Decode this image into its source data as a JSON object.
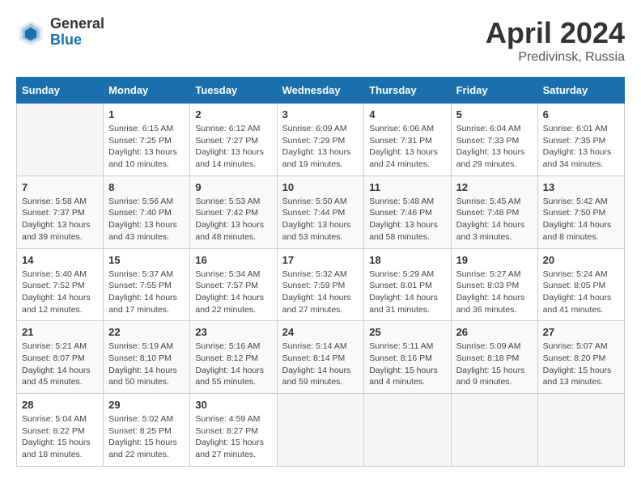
{
  "header": {
    "logo_general": "General",
    "logo_blue": "Blue",
    "title": "April 2024",
    "location": "Predivinsk, Russia"
  },
  "days_of_week": [
    "Sunday",
    "Monday",
    "Tuesday",
    "Wednesday",
    "Thursday",
    "Friday",
    "Saturday"
  ],
  "weeks": [
    [
      {
        "day": "",
        "info": ""
      },
      {
        "day": "1",
        "info": "Sunrise: 6:15 AM\nSunset: 7:25 PM\nDaylight: 13 hours\nand 10 minutes."
      },
      {
        "day": "2",
        "info": "Sunrise: 6:12 AM\nSunset: 7:27 PM\nDaylight: 13 hours\nand 14 minutes."
      },
      {
        "day": "3",
        "info": "Sunrise: 6:09 AM\nSunset: 7:29 PM\nDaylight: 13 hours\nand 19 minutes."
      },
      {
        "day": "4",
        "info": "Sunrise: 6:06 AM\nSunset: 7:31 PM\nDaylight: 13 hours\nand 24 minutes."
      },
      {
        "day": "5",
        "info": "Sunrise: 6:04 AM\nSunset: 7:33 PM\nDaylight: 13 hours\nand 29 minutes."
      },
      {
        "day": "6",
        "info": "Sunrise: 6:01 AM\nSunset: 7:35 PM\nDaylight: 13 hours\nand 34 minutes."
      }
    ],
    [
      {
        "day": "7",
        "info": "Sunrise: 5:58 AM\nSunset: 7:37 PM\nDaylight: 13 hours\nand 39 minutes."
      },
      {
        "day": "8",
        "info": "Sunrise: 5:56 AM\nSunset: 7:40 PM\nDaylight: 13 hours\nand 43 minutes."
      },
      {
        "day": "9",
        "info": "Sunrise: 5:53 AM\nSunset: 7:42 PM\nDaylight: 13 hours\nand 48 minutes."
      },
      {
        "day": "10",
        "info": "Sunrise: 5:50 AM\nSunset: 7:44 PM\nDaylight: 13 hours\nand 53 minutes."
      },
      {
        "day": "11",
        "info": "Sunrise: 5:48 AM\nSunset: 7:46 PM\nDaylight: 13 hours\nand 58 minutes."
      },
      {
        "day": "12",
        "info": "Sunrise: 5:45 AM\nSunset: 7:48 PM\nDaylight: 14 hours\nand 3 minutes."
      },
      {
        "day": "13",
        "info": "Sunrise: 5:42 AM\nSunset: 7:50 PM\nDaylight: 14 hours\nand 8 minutes."
      }
    ],
    [
      {
        "day": "14",
        "info": "Sunrise: 5:40 AM\nSunset: 7:52 PM\nDaylight: 14 hours\nand 12 minutes."
      },
      {
        "day": "15",
        "info": "Sunrise: 5:37 AM\nSunset: 7:55 PM\nDaylight: 14 hours\nand 17 minutes."
      },
      {
        "day": "16",
        "info": "Sunrise: 5:34 AM\nSunset: 7:57 PM\nDaylight: 14 hours\nand 22 minutes."
      },
      {
        "day": "17",
        "info": "Sunrise: 5:32 AM\nSunset: 7:59 PM\nDaylight: 14 hours\nand 27 minutes."
      },
      {
        "day": "18",
        "info": "Sunrise: 5:29 AM\nSunset: 8:01 PM\nDaylight: 14 hours\nand 31 minutes."
      },
      {
        "day": "19",
        "info": "Sunrise: 5:27 AM\nSunset: 8:03 PM\nDaylight: 14 hours\nand 36 minutes."
      },
      {
        "day": "20",
        "info": "Sunrise: 5:24 AM\nSunset: 8:05 PM\nDaylight: 14 hours\nand 41 minutes."
      }
    ],
    [
      {
        "day": "21",
        "info": "Sunrise: 5:21 AM\nSunset: 8:07 PM\nDaylight: 14 hours\nand 45 minutes."
      },
      {
        "day": "22",
        "info": "Sunrise: 5:19 AM\nSunset: 8:10 PM\nDaylight: 14 hours\nand 50 minutes."
      },
      {
        "day": "23",
        "info": "Sunrise: 5:16 AM\nSunset: 8:12 PM\nDaylight: 14 hours\nand 55 minutes."
      },
      {
        "day": "24",
        "info": "Sunrise: 5:14 AM\nSunset: 8:14 PM\nDaylight: 14 hours\nand 59 minutes."
      },
      {
        "day": "25",
        "info": "Sunrise: 5:11 AM\nSunset: 8:16 PM\nDaylight: 15 hours\nand 4 minutes."
      },
      {
        "day": "26",
        "info": "Sunrise: 5:09 AM\nSunset: 8:18 PM\nDaylight: 15 hours\nand 9 minutes."
      },
      {
        "day": "27",
        "info": "Sunrise: 5:07 AM\nSunset: 8:20 PM\nDaylight: 15 hours\nand 13 minutes."
      }
    ],
    [
      {
        "day": "28",
        "info": "Sunrise: 5:04 AM\nSunset: 8:22 PM\nDaylight: 15 hours\nand 18 minutes."
      },
      {
        "day": "29",
        "info": "Sunrise: 5:02 AM\nSunset: 8:25 PM\nDaylight: 15 hours\nand 22 minutes."
      },
      {
        "day": "30",
        "info": "Sunrise: 4:59 AM\nSunset: 8:27 PM\nDaylight: 15 hours\nand 27 minutes."
      },
      {
        "day": "",
        "info": ""
      },
      {
        "day": "",
        "info": ""
      },
      {
        "day": "",
        "info": ""
      },
      {
        "day": "",
        "info": ""
      }
    ]
  ]
}
